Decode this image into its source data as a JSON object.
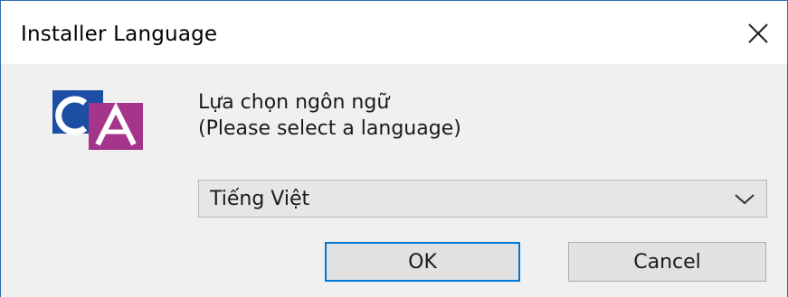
{
  "window": {
    "title": "Installer Language"
  },
  "icons": {
    "close": "close-icon",
    "logo": "ca-logo-icon",
    "dropdown": "chevron-down-icon"
  },
  "dialog": {
    "prompt_line1": "Lựa chọn ngôn ngữ",
    "prompt_line2": "(Please select a language)",
    "language_select": {
      "selected": "Tiếng Việt"
    },
    "ok_label": "OK",
    "cancel_label": "Cancel"
  },
  "colors": {
    "accent": "#0078d7",
    "logo_blue": "#1c4fa3",
    "logo_magenta": "#a4358a",
    "window_border": "#2b6cb0",
    "background": "#f0f0f0"
  }
}
